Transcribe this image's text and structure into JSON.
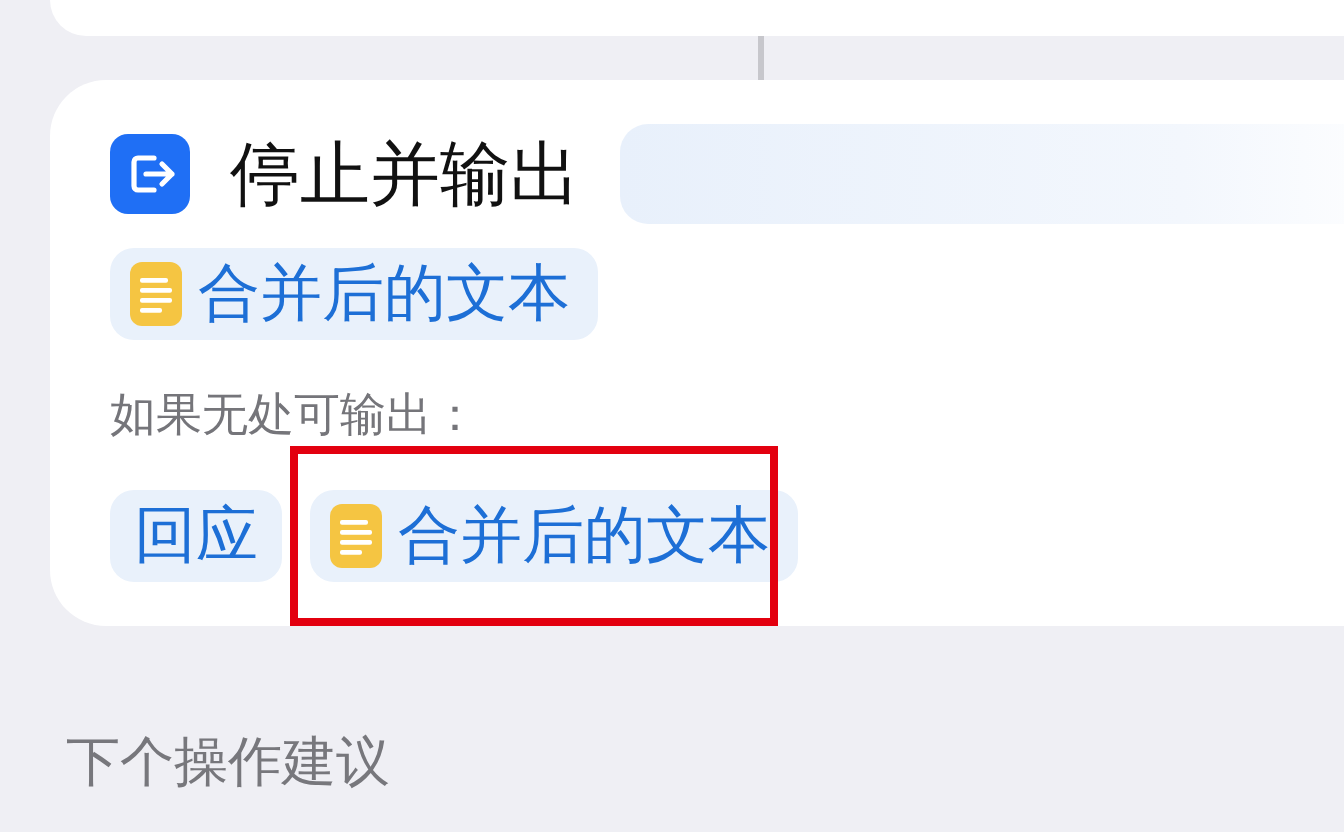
{
  "action": {
    "title": "停止并输出",
    "output": {
      "label": "合并后的文本",
      "kind": "variable"
    },
    "fallback_label": "如果无处可输出：",
    "fallback_options": [
      {
        "label": "回应",
        "kind": "plain",
        "highlighted": false
      },
      {
        "label": "合并后的文本",
        "kind": "variable",
        "highlighted": true
      }
    ]
  },
  "next_section": {
    "title": "下个操作建议"
  }
}
